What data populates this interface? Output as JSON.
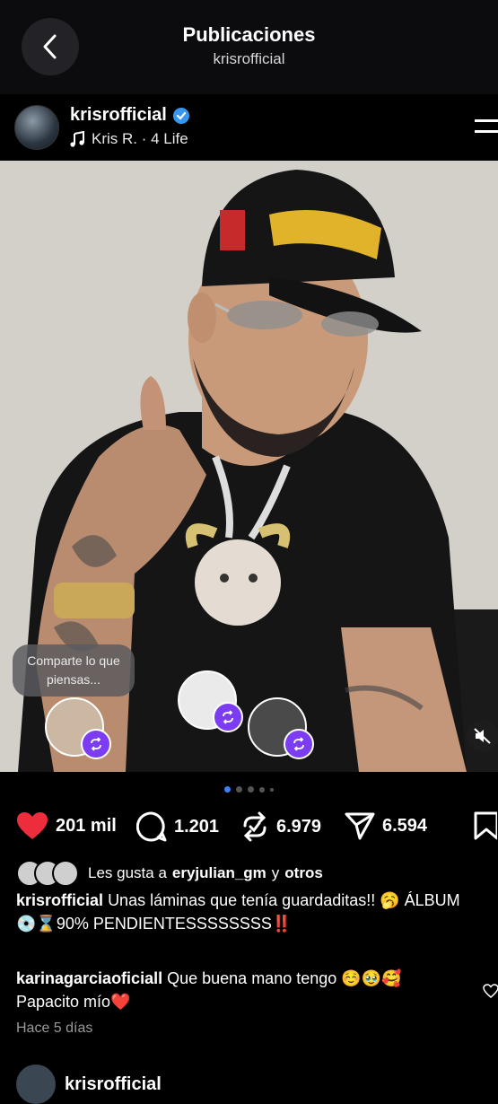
{
  "header": {
    "title": "Publicaciones",
    "subtitle": "krisrofficial"
  },
  "post": {
    "username": "krisrofficial",
    "music": "Kris R. · 4 Life",
    "note_bubble": "Comparte lo que piensas...",
    "carousel": {
      "count": 5,
      "active": 0
    },
    "actions": {
      "likes": "201 mil",
      "comments": "1.201",
      "reposts": "6.979",
      "shares": "6.594"
    },
    "liked_by": {
      "prefix": "Les gusta a ",
      "user": "eryjulian_gm",
      "middle": " y ",
      "others": "otros"
    },
    "caption": {
      "user": "krisrofficial",
      "text": "Unas láminas que tenía guardaditas!! 🥱 ÁLBUM 💿⌛90% PENDIENTESSSSSSSS‼️"
    },
    "comment": {
      "user": "karinagarciaoficiall",
      "text": "Que buena mano tengo ☺️🥹🥰 Papacito mío❤️"
    },
    "time": "Hace 5 días"
  },
  "next_post": {
    "username": "krisrofficial"
  },
  "colors": {
    "like": "#ed2c3c",
    "repost_badge": "#7b3cf2",
    "verified": "#3797f0",
    "dot_active": "#3b82f6"
  }
}
